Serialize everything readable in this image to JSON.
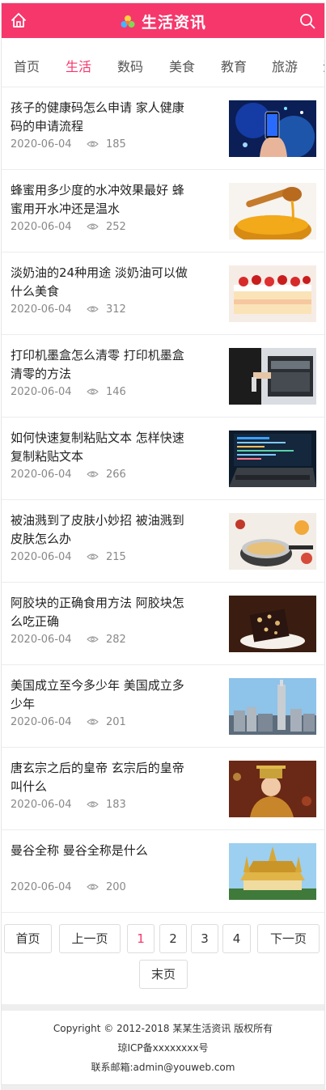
{
  "header": {
    "title": "生活资讯",
    "accent": "#f6376c",
    "home_icon": "home-icon",
    "search_icon": "search-icon"
  },
  "nav": [
    {
      "label": "首页",
      "active": false
    },
    {
      "label": "生活",
      "active": true
    },
    {
      "label": "数码",
      "active": false
    },
    {
      "label": "美食",
      "active": false
    },
    {
      "label": "教育",
      "active": false
    },
    {
      "label": "旅游",
      "active": false
    }
  ],
  "articles": [
    {
      "title": "孩子的健康码怎么申请 家人健康码的申请流程",
      "date": "2020-06-04",
      "views": "185",
      "thumb": "phone"
    },
    {
      "title": "蜂蜜用多少度的水冲效果最好 蜂蜜用开水冲还是温水",
      "date": "2020-06-04",
      "views": "252",
      "thumb": "honey"
    },
    {
      "title": "淡奶油的24种用途 淡奶油可以做什么美食",
      "date": "2020-06-04",
      "views": "312",
      "thumb": "cake"
    },
    {
      "title": "打印机墨盒怎么清零 打印机墨盒清零的方法",
      "date": "2020-06-04",
      "views": "146",
      "thumb": "printer"
    },
    {
      "title": "如何快速复制粘贴文本 怎样快速复制粘贴文本",
      "date": "2020-06-04",
      "views": "266",
      "thumb": "laptop"
    },
    {
      "title": "被油溅到了皮肤小妙招 被油溅到皮肤怎么办",
      "date": "2020-06-04",
      "views": "215",
      "thumb": "cooking"
    },
    {
      "title": "阿胶块的正确食用方法 阿胶块怎么吃正确",
      "date": "2020-06-04",
      "views": "282",
      "thumb": "ejiao"
    },
    {
      "title": "美国成立至今多少年 美国成立多少年",
      "date": "2020-06-04",
      "views": "201",
      "thumb": "city"
    },
    {
      "title": "唐玄宗之后的皇帝 玄宗后的皇帝叫什么",
      "date": "2020-06-04",
      "views": "183",
      "thumb": "emperor"
    },
    {
      "title": "曼谷全称 曼谷全称是什么",
      "date": "2020-06-04",
      "views": "200",
      "thumb": "temple"
    }
  ],
  "pagination": {
    "first": "首页",
    "prev": "上一页",
    "pages": [
      "1",
      "2",
      "3",
      "4"
    ],
    "current": "1",
    "next": "下一页",
    "last": "末页"
  },
  "footer": {
    "copyright": "Copyright © 2012-2018 某某生活资讯 版权所有",
    "icp": "琼ICP备xxxxxxxx号",
    "email": "联系邮箱:admin@youweb.com"
  }
}
